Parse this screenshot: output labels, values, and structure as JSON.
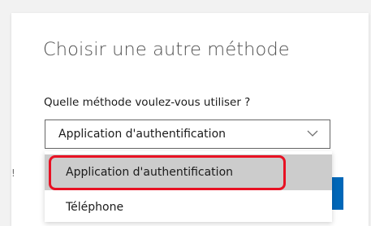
{
  "dialog": {
    "title": "Choisir une autre méthode",
    "question": "Quelle méthode voulez-vous utiliser ?"
  },
  "method_select": {
    "selected_value": "Application d'authentification",
    "chevron_icon": "chevron-down-icon",
    "options": [
      {
        "label": "Application d'authentification",
        "highlighted": true
      },
      {
        "label": "Téléphone",
        "highlighted": false
      }
    ]
  },
  "colors": {
    "highlight_border": "#e81123",
    "option_hover_bg": "#cccccc",
    "primary_button": "#0067b8",
    "select_border": "#666666"
  }
}
